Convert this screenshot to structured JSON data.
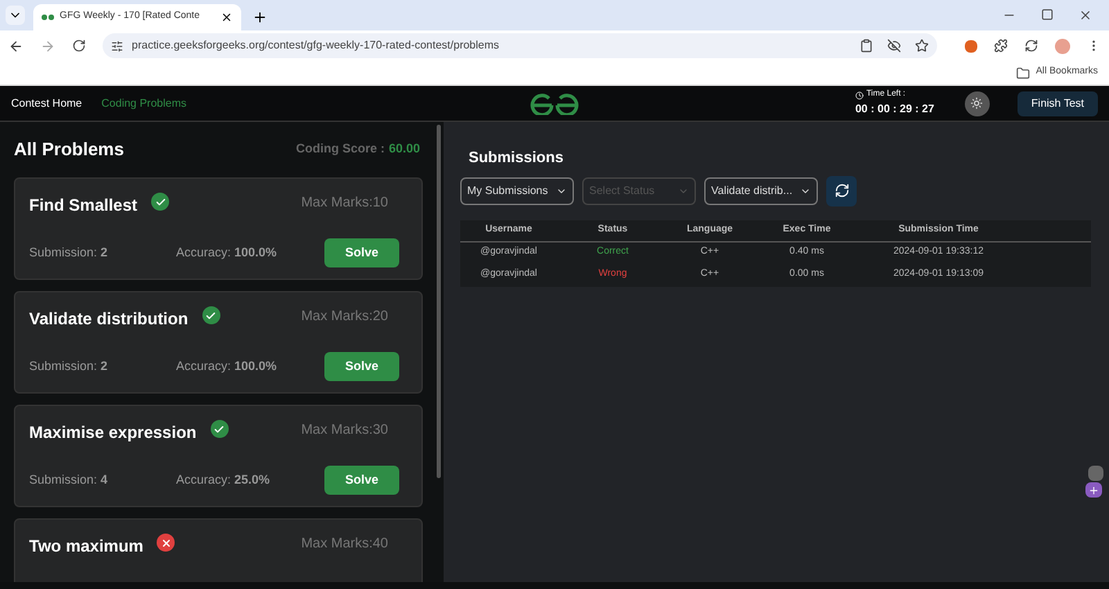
{
  "browser": {
    "tab_title": "GFG Weekly - 170 [Rated Conte",
    "url": "practice.geeksforgeeks.org/contest/gfg-weekly-170-rated-contest/problems",
    "bookmarks_label": "All Bookmarks"
  },
  "nav": {
    "items": [
      {
        "label": "Contest Home",
        "selected": false
      },
      {
        "label": "Coding Problems",
        "selected": true
      }
    ],
    "time_label": "Time Left :",
    "time_value": "00 : 00 : 29 : 27",
    "finish_button": "Finish Test"
  },
  "problems": {
    "title": "All Problems",
    "score_label": "Coding Score :",
    "score_value": "60.00",
    "items": [
      {
        "title": "Find Smallest",
        "solved": true,
        "max_marks": "Max Marks:10",
        "submissions": "Submission: **2**",
        "accuracy": "Accuracy: **100.0%**",
        "button": "Solve"
      },
      {
        "title": "Validate distribution",
        "solved": true,
        "max_marks": "Max Marks:20",
        "submissions": "Submission: **2**",
        "accuracy": "Accuracy: **100.0%**",
        "button": "Solve"
      },
      {
        "title": "Maximise expression",
        "solved": true,
        "max_marks": "Max Marks:30",
        "submissions": "Submission: **4**",
        "accuracy": "Accuracy: **25.0%**",
        "button": "Solve"
      },
      {
        "title": "Two maximum",
        "solved": false,
        "max_marks": "Max Marks:40"
      }
    ]
  },
  "submissions": {
    "title": "Submissions",
    "filters": [
      {
        "value": "My Submissions",
        "disabled": false
      },
      {
        "placeholder": "Select Status",
        "disabled": true
      },
      {
        "value": "Validate distrib...",
        "disabled": false
      }
    ],
    "columns": [
      "Username",
      "Status",
      "Language",
      "Exec Time",
      "Submission Time"
    ],
    "rows": [
      {
        "username": "@goravjindal",
        "status": "Correct",
        "kind": "correct",
        "language": "C++",
        "exec_time": "0.40 ms",
        "time": "2024-09-01 19:33:12"
      },
      {
        "username": "@goravjindal",
        "status": "Wrong",
        "kind": "wrong",
        "language": "C++",
        "exec_time": "0.00 ms",
        "time": "2024-09-01 19:13:09"
      }
    ]
  }
}
